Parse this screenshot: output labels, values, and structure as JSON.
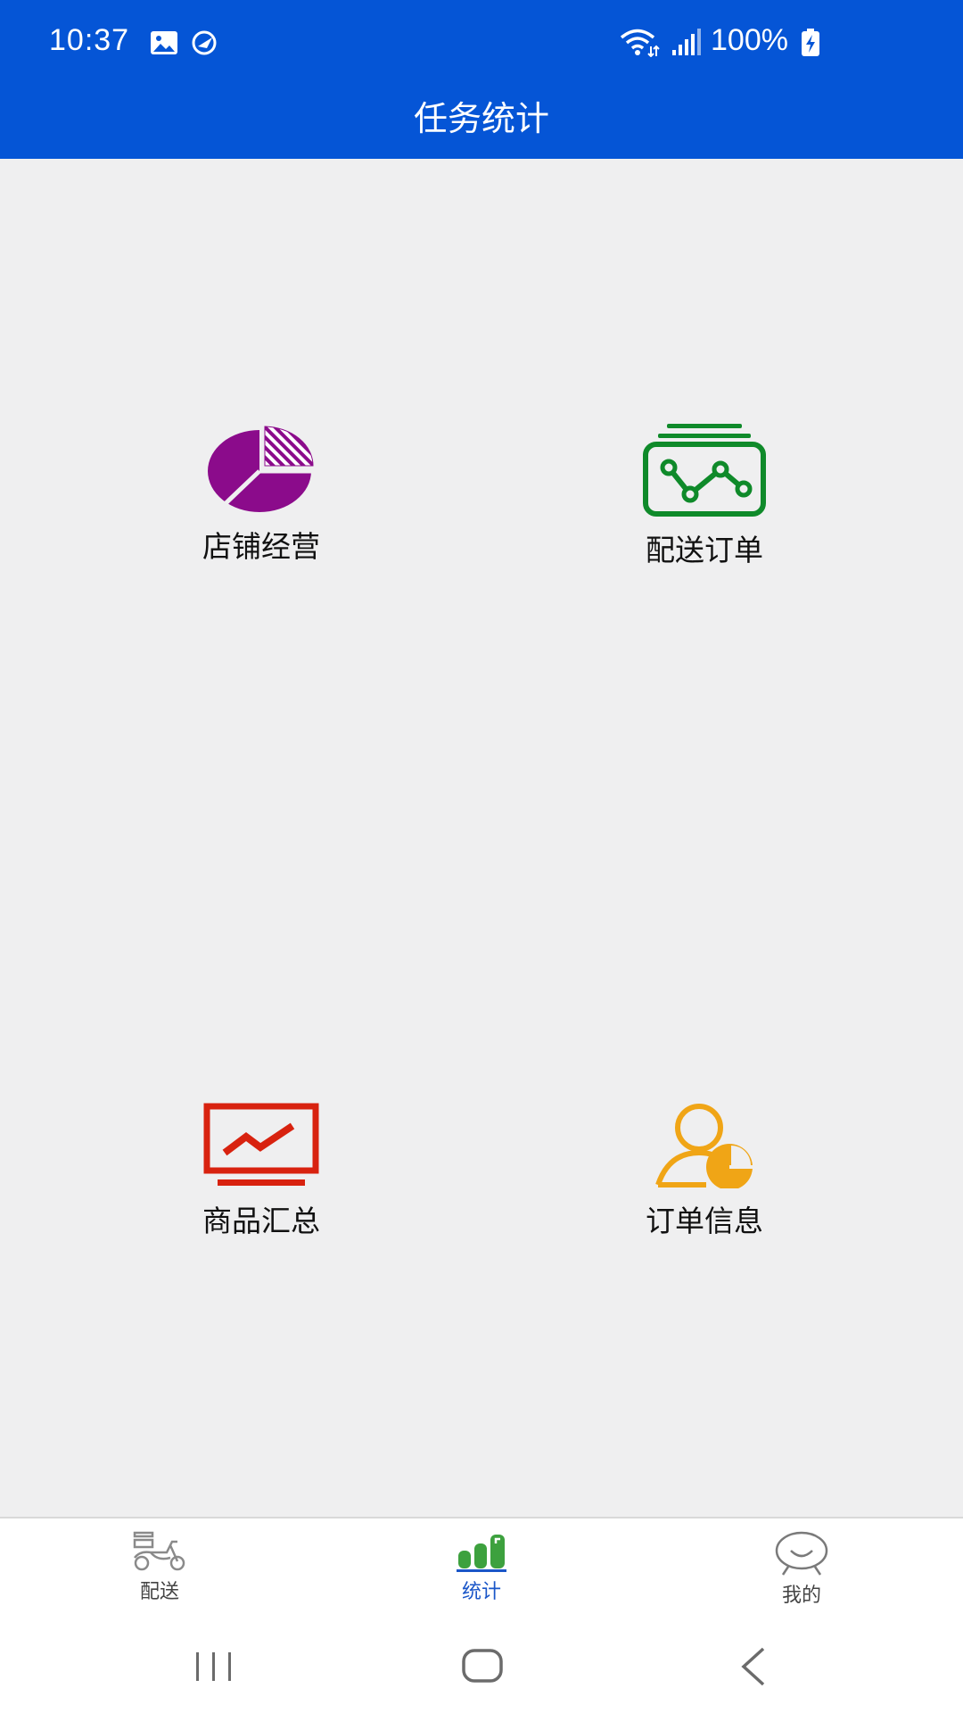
{
  "status_bar": {
    "time": "10:37",
    "battery": "100%",
    "icons": [
      "image-icon",
      "app-notification-icon",
      "wifi-icon",
      "signal-icon",
      "battery-charging-icon"
    ]
  },
  "header": {
    "title": "任务统计",
    "background_color": "#0555d6"
  },
  "tiles": [
    {
      "label": "店铺经营",
      "icon": "pie-chart-icon",
      "color": "#8b0b8b"
    },
    {
      "label": "配送订单",
      "icon": "line-chart-card-icon",
      "color": "#0f8a2a"
    },
    {
      "label": "商品汇总",
      "icon": "monitor-trend-icon",
      "color": "#d8220f"
    },
    {
      "label": "订单信息",
      "icon": "user-pie-icon",
      "color": "#f0a516"
    }
  ],
  "bottom_nav": {
    "items": [
      {
        "label": "配送",
        "icon": "scooter-icon",
        "active": false
      },
      {
        "label": "统计",
        "icon": "bar-stats-icon",
        "active": true
      },
      {
        "label": "我的",
        "icon": "smiley-profile-icon",
        "active": false
      }
    ],
    "active_color": "#1a56c8"
  },
  "system_nav": {
    "buttons": [
      "recent-apps-icon",
      "home-icon",
      "back-icon"
    ]
  }
}
